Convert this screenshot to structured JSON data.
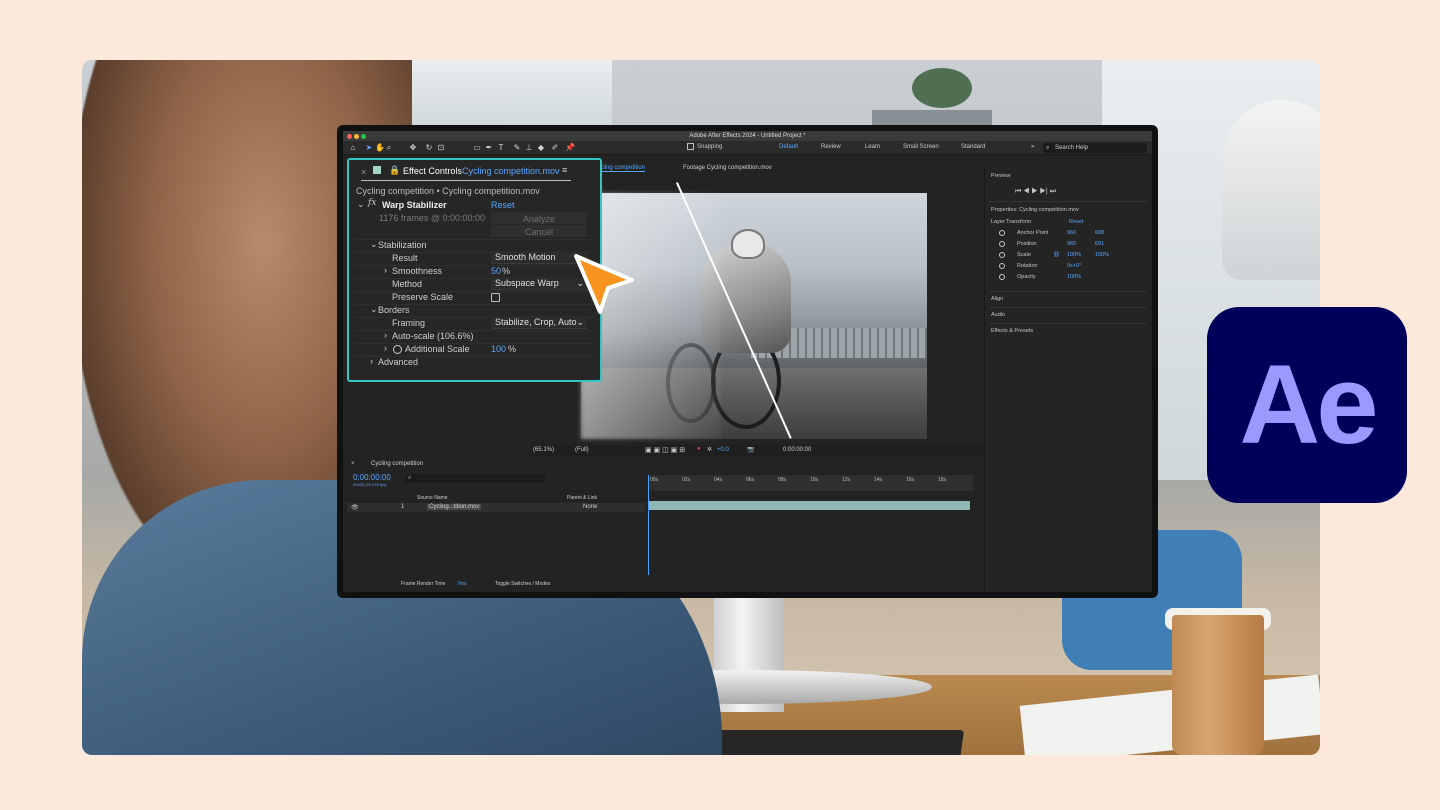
{
  "app": {
    "window_title": "Adobe After Effects 2024 - Untitled Project *",
    "brand_color": "#00005b",
    "brand_text_color": "#9999ff",
    "logo_text": "Ae"
  },
  "toolbar": {
    "snapping_label": "Snapping",
    "workspaces": [
      "Default",
      "Review",
      "Learn",
      "Small Screen",
      "Standard"
    ],
    "active_workspace": "Default",
    "search_placeholder": "Search Help"
  },
  "effect_controls": {
    "tab_label": "Effect Controls",
    "tab_layer": "Cycling competition.mov",
    "header": "Cycling competition • Cycling competition.mov",
    "effect_name": "Warp Stabilizer",
    "reset_label": "Reset",
    "frames_info": "1176 frames @ 0:00:00:00",
    "analyze_label": "Analyze",
    "cancel_label": "Cancel",
    "stabilization_label": "Stabilization",
    "result_label": "Result",
    "result_value": "Smooth Motion",
    "smoothness_label": "Smoothness",
    "smoothness_value": "50",
    "percent": "%",
    "method_label": "Method",
    "method_value": "Subspace Warp",
    "preserve_scale_label": "Preserve Scale",
    "borders_label": "Borders",
    "framing_label": "Framing",
    "framing_value": "Stabilize, Crop, Auto",
    "autoscale_label": "Auto-scale (106.6%)",
    "additional_scale_label": "Additional Scale",
    "additional_scale_value": "100",
    "advanced_label": "Advanced"
  },
  "comp_panel": {
    "tab_comp": "Cycling competition",
    "tab_footage": "Footage Cycling competition.mov",
    "zoom": "(65.1%)",
    "resolution": "(Full)",
    "exposure": "+0.0",
    "timecode": "0:00:00:00"
  },
  "right_panel": {
    "preview_label": "Preview",
    "properties_label": "Properties: Cycling competition.mov",
    "layer_transform_label": "Layer Transform",
    "reset_label": "Reset",
    "rows": [
      {
        "label": "Anchor Point",
        "v1": "960",
        "v2": "688"
      },
      {
        "label": "Position",
        "v1": "960",
        "v2": "691"
      },
      {
        "label": "Scale",
        "v1": "100%",
        "v2": "100%"
      },
      {
        "label": "Rotation",
        "v1": "0x+0°",
        "v2": ""
      },
      {
        "label": "Opacity",
        "v1": "100%",
        "v2": ""
      }
    ],
    "sections": [
      "Align",
      "Audio",
      "Effects & Presets"
    ]
  },
  "timeline": {
    "comp_name": "Cycling competition",
    "timecode": "0:00:00:00",
    "fps_info": "00000 (29.970 fps)",
    "source_name_header": "Source Name",
    "parent_link_header": "Parent & Link",
    "layer_index": "1",
    "layer_name": "Cycling...tition.mov",
    "parent_value": "None",
    "ruler_ticks": [
      "00s",
      "02s",
      "04s",
      "06s",
      "08s",
      "10s",
      "12s",
      "14s",
      "16s",
      "18s"
    ],
    "frame_render_label": "Frame Render Time",
    "frame_render_value": "7ms",
    "toggle_label": "Toggle Switches / Modes"
  },
  "cursor_color": "#f7931e",
  "highlight_color": "#35c4c4",
  "accent_blue": "#5aa6ff"
}
